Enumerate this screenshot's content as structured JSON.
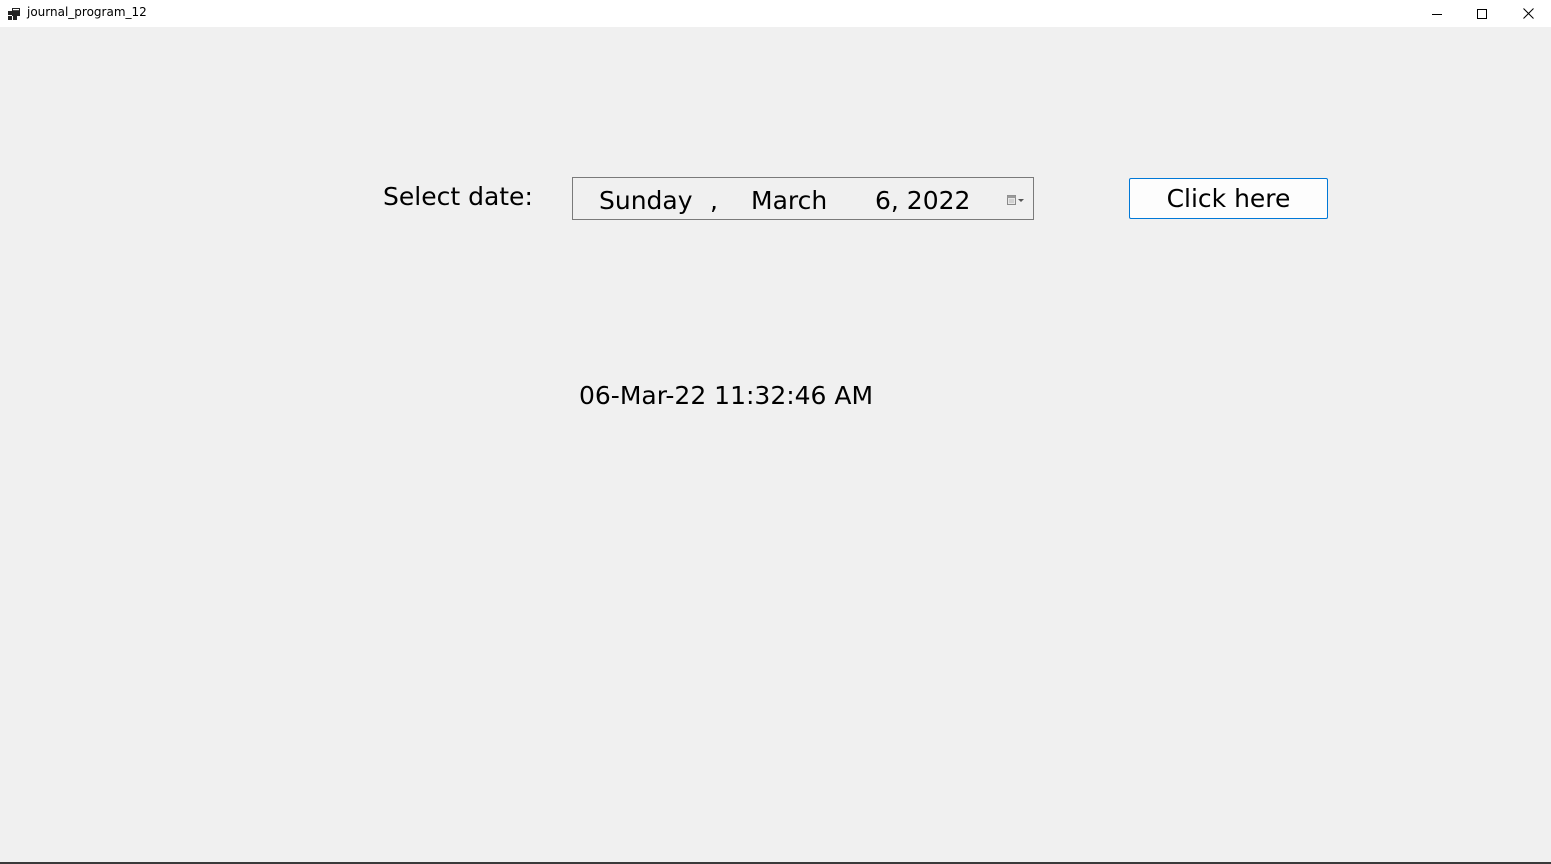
{
  "window": {
    "title": "journal_program_12",
    "icons": {
      "app": "app-window-icon",
      "minimize": "minimize-icon",
      "maximize": "maximize-icon",
      "close": "close-icon"
    }
  },
  "form": {
    "select_label": "Select date:",
    "date_picker": {
      "weekday": "Sunday",
      "comma": ",",
      "month": "March",
      "day_year": "6, 2022",
      "dropdown_icon": "calendar-dropdown-icon"
    },
    "button_label": "Click here",
    "result_text": "06-Mar-22 11:32:46 AM"
  },
  "colors": {
    "background": "#f0f0f0",
    "titlebar": "#ffffff",
    "button_border": "#0078d7",
    "picker_border": "#7a7a7a"
  }
}
